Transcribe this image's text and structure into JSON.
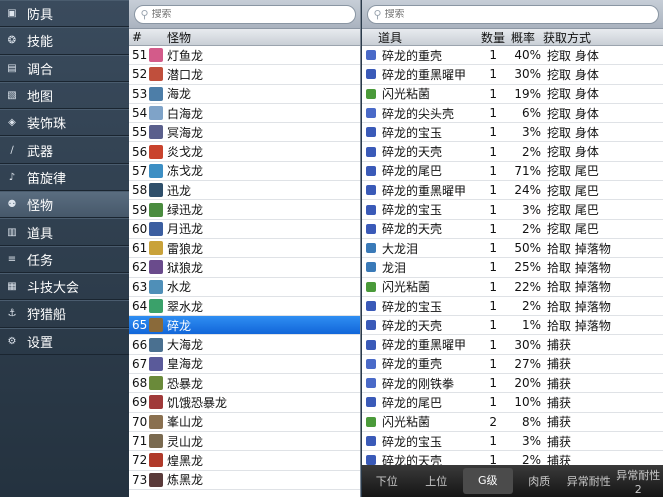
{
  "sidebar": {
    "items": [
      {
        "label": "防具",
        "icon": "armor-icon"
      },
      {
        "label": "技能",
        "icon": "skill-icon"
      },
      {
        "label": "调合",
        "icon": "combine-icon"
      },
      {
        "label": "地图",
        "icon": "map-icon"
      },
      {
        "label": "装饰珠",
        "icon": "jewel-icon"
      },
      {
        "label": "武器",
        "icon": "weapon-icon"
      },
      {
        "label": "笛旋律",
        "icon": "melody-icon"
      },
      {
        "label": "怪物",
        "icon": "monster-icon"
      },
      {
        "label": "道具",
        "icon": "item-icon"
      },
      {
        "label": "任务",
        "icon": "quest-icon"
      },
      {
        "label": "斗技大会",
        "icon": "arena-icon"
      },
      {
        "label": "狩猎船",
        "icon": "ship-icon"
      },
      {
        "label": "设置",
        "icon": "settings-icon"
      }
    ],
    "selected": 7
  },
  "monster_list": {
    "search_placeholder": "搜索",
    "headers": {
      "num": "#",
      "name": "怪物"
    },
    "rows": [
      {
        "n": "51",
        "name": "灯鱼龙",
        "c": "#d35b8a"
      },
      {
        "n": "52",
        "name": "潜口龙",
        "c": "#c04f3c"
      },
      {
        "n": "53",
        "name": "海龙",
        "c": "#4d7ea8"
      },
      {
        "n": "54",
        "name": "白海龙",
        "c": "#7fa3c8"
      },
      {
        "n": "55",
        "name": "冥海龙",
        "c": "#5a5f8c"
      },
      {
        "n": "56",
        "name": "炎戈龙",
        "c": "#c9432d"
      },
      {
        "n": "57",
        "name": "冻戈龙",
        "c": "#3d8fc4"
      },
      {
        "n": "58",
        "name": "迅龙",
        "c": "#2f4f6b"
      },
      {
        "n": "59",
        "name": "绿迅龙",
        "c": "#4a8c3f"
      },
      {
        "n": "60",
        "name": "月迅龙",
        "c": "#3b5ea0"
      },
      {
        "n": "61",
        "name": "雷狼龙",
        "c": "#c9a23a"
      },
      {
        "n": "62",
        "name": "狱狼龙",
        "c": "#6a4b8c"
      },
      {
        "n": "63",
        "name": "水龙",
        "c": "#4f8fb8"
      },
      {
        "n": "64",
        "name": "翠水龙",
        "c": "#3aa16a"
      },
      {
        "n": "65",
        "name": "碎龙",
        "c": "#8a6a3a"
      },
      {
        "n": "66",
        "name": "大海龙",
        "c": "#4a7090"
      },
      {
        "n": "67",
        "name": "皇海龙",
        "c": "#5a5a9a"
      },
      {
        "n": "68",
        "name": "恐暴龙",
        "c": "#6a8a3a"
      },
      {
        "n": "69",
        "name": "饥饿恐暴龙",
        "c": "#a03a3a"
      },
      {
        "n": "70",
        "name": "峯山龙",
        "c": "#8a7050"
      },
      {
        "n": "71",
        "name": "灵山龙",
        "c": "#7a6a50"
      },
      {
        "n": "72",
        "name": "煌黑龙",
        "c": "#b03a2a"
      },
      {
        "n": "73",
        "name": "炼黑龙",
        "c": "#5a3a3a"
      }
    ],
    "selected": 14
  },
  "items_table": {
    "search_placeholder": "搜索",
    "headers": {
      "item": "道具",
      "qty": "数量",
      "rate": "概率",
      "method": "获取方式"
    },
    "rows": [
      {
        "item": "碎龙的重壳",
        "qty": "1",
        "rate": "40%",
        "method": "挖取 身体",
        "c": "#4a6ac8"
      },
      {
        "item": "碎龙的重黑曜甲",
        "qty": "1",
        "rate": "30%",
        "method": "挖取 身体",
        "c": "#3a5ab8"
      },
      {
        "item": "闪光粘菌",
        "qty": "1",
        "rate": "19%",
        "method": "挖取 身体",
        "c": "#4a9a3a"
      },
      {
        "item": "碎龙的尖头壳",
        "qty": "1",
        "rate": "6%",
        "method": "挖取 身体",
        "c": "#4a6ac8"
      },
      {
        "item": "碎龙的宝玉",
        "qty": "1",
        "rate": "3%",
        "method": "挖取 身体",
        "c": "#3a5ab8"
      },
      {
        "item": "碎龙的天壳",
        "qty": "1",
        "rate": "2%",
        "method": "挖取 身体",
        "c": "#3a5ab8"
      },
      {
        "item": "碎龙的尾巴",
        "qty": "1",
        "rate": "71%",
        "method": "挖取 尾巴",
        "c": "#3a5ab8"
      },
      {
        "item": "碎龙的重黑曜甲",
        "qty": "1",
        "rate": "24%",
        "method": "挖取 尾巴",
        "c": "#3a5ab8"
      },
      {
        "item": "碎龙的宝玉",
        "qty": "1",
        "rate": "3%",
        "method": "挖取 尾巴",
        "c": "#3a5ab8"
      },
      {
        "item": "碎龙的天壳",
        "qty": "1",
        "rate": "2%",
        "method": "挖取 尾巴",
        "c": "#3a5ab8"
      },
      {
        "item": "大龙泪",
        "qty": "1",
        "rate": "50%",
        "method": "拾取 掉落物",
        "c": "#3a7ab8"
      },
      {
        "item": "龙泪",
        "qty": "1",
        "rate": "25%",
        "method": "拾取 掉落物",
        "c": "#3a7ab8"
      },
      {
        "item": "闪光粘菌",
        "qty": "1",
        "rate": "22%",
        "method": "拾取 掉落物",
        "c": "#4a9a3a"
      },
      {
        "item": "碎龙的宝玉",
        "qty": "1",
        "rate": "2%",
        "method": "拾取 掉落物",
        "c": "#3a5ab8"
      },
      {
        "item": "碎龙的天壳",
        "qty": "1",
        "rate": "1%",
        "method": "拾取 掉落物",
        "c": "#3a5ab8"
      },
      {
        "item": "碎龙的重黑曜甲",
        "qty": "1",
        "rate": "30%",
        "method": "捕获",
        "c": "#3a5ab8"
      },
      {
        "item": "碎龙的重壳",
        "qty": "1",
        "rate": "27%",
        "method": "捕获",
        "c": "#4a6ac8"
      },
      {
        "item": "碎龙的刚铁拳",
        "qty": "1",
        "rate": "20%",
        "method": "捕获",
        "c": "#4a6ac8"
      },
      {
        "item": "碎龙的尾巴",
        "qty": "1",
        "rate": "10%",
        "method": "捕获",
        "c": "#3a5ab8"
      },
      {
        "item": "闪光粘菌",
        "qty": "2",
        "rate": "8%",
        "method": "捕获",
        "c": "#4a9a3a"
      },
      {
        "item": "碎龙的宝玉",
        "qty": "1",
        "rate": "3%",
        "method": "捕获",
        "c": "#3a5ab8"
      },
      {
        "item": "碎龙的天壳",
        "qty": "1",
        "rate": "2%",
        "method": "捕获",
        "c": "#3a5ab8"
      }
    ]
  },
  "tabs": {
    "items": [
      "下位",
      "上位",
      "G级",
      "肉质",
      "异常耐性",
      "异常耐性2"
    ],
    "selected": 2
  }
}
